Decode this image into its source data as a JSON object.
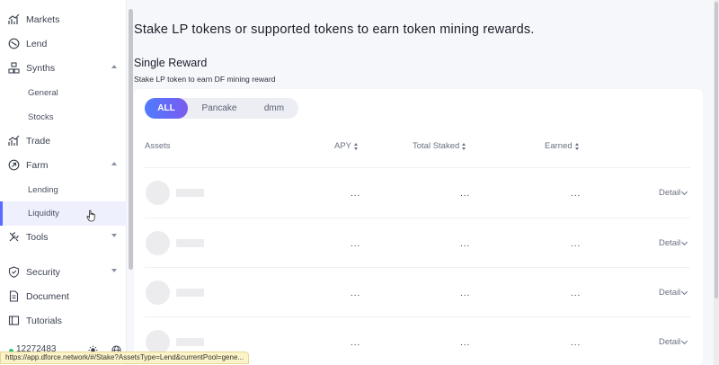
{
  "sidebar": {
    "items": [
      {
        "label": "Markets",
        "icon": "chart-icon"
      },
      {
        "label": "Lend",
        "icon": "lend-icon"
      },
      {
        "label": "Synths",
        "icon": "synths-icon",
        "expanded": true
      },
      {
        "label": "General"
      },
      {
        "label": "Stocks"
      },
      {
        "label": "Trade",
        "icon": "trade-icon"
      },
      {
        "label": "Farm",
        "icon": "farm-icon",
        "expanded": true
      },
      {
        "label": "Lending"
      },
      {
        "label": "Liquidity",
        "active": true
      },
      {
        "label": "Tools",
        "icon": "tools-icon",
        "expanded": false
      },
      {
        "label": "Security",
        "icon": "shield-icon",
        "expanded": false
      },
      {
        "label": "Document",
        "icon": "document-icon"
      },
      {
        "label": "Tutorials",
        "icon": "tutorials-icon"
      }
    ],
    "footer": {
      "block_number": "12272483",
      "status_color": "#2fbf71"
    }
  },
  "main": {
    "title": "Stake LP tokens or supported tokens to earn token mining rewards.",
    "section_title": "Single Reward",
    "section_subtitle": "Stake LP token to earn DF mining reward",
    "tabs": [
      {
        "label": "ALL",
        "active": true
      },
      {
        "label": "Pancake"
      },
      {
        "label": "dmm"
      }
    ],
    "columns": [
      "Assets",
      "APY",
      "Total Staked",
      "Earned"
    ],
    "rows": [
      {
        "apy": "...",
        "total_staked": "...",
        "earned": "...",
        "action": "Detail"
      },
      {
        "apy": "...",
        "total_staked": "...",
        "earned": "...",
        "action": "Detail"
      },
      {
        "apy": "...",
        "total_staked": "...",
        "earned": "...",
        "action": "Detail"
      },
      {
        "apy": "...",
        "total_staked": "...",
        "earned": "...",
        "action": "Detail"
      }
    ]
  },
  "statusbar": {
    "url": "https://app.dforce.network/#/Stake?AssetsType=Lend&currentPool=gene..."
  },
  "colors": {
    "accent_start": "#4f7bff",
    "accent_end": "#7a5bef",
    "active_bg": "#eef0fd"
  }
}
